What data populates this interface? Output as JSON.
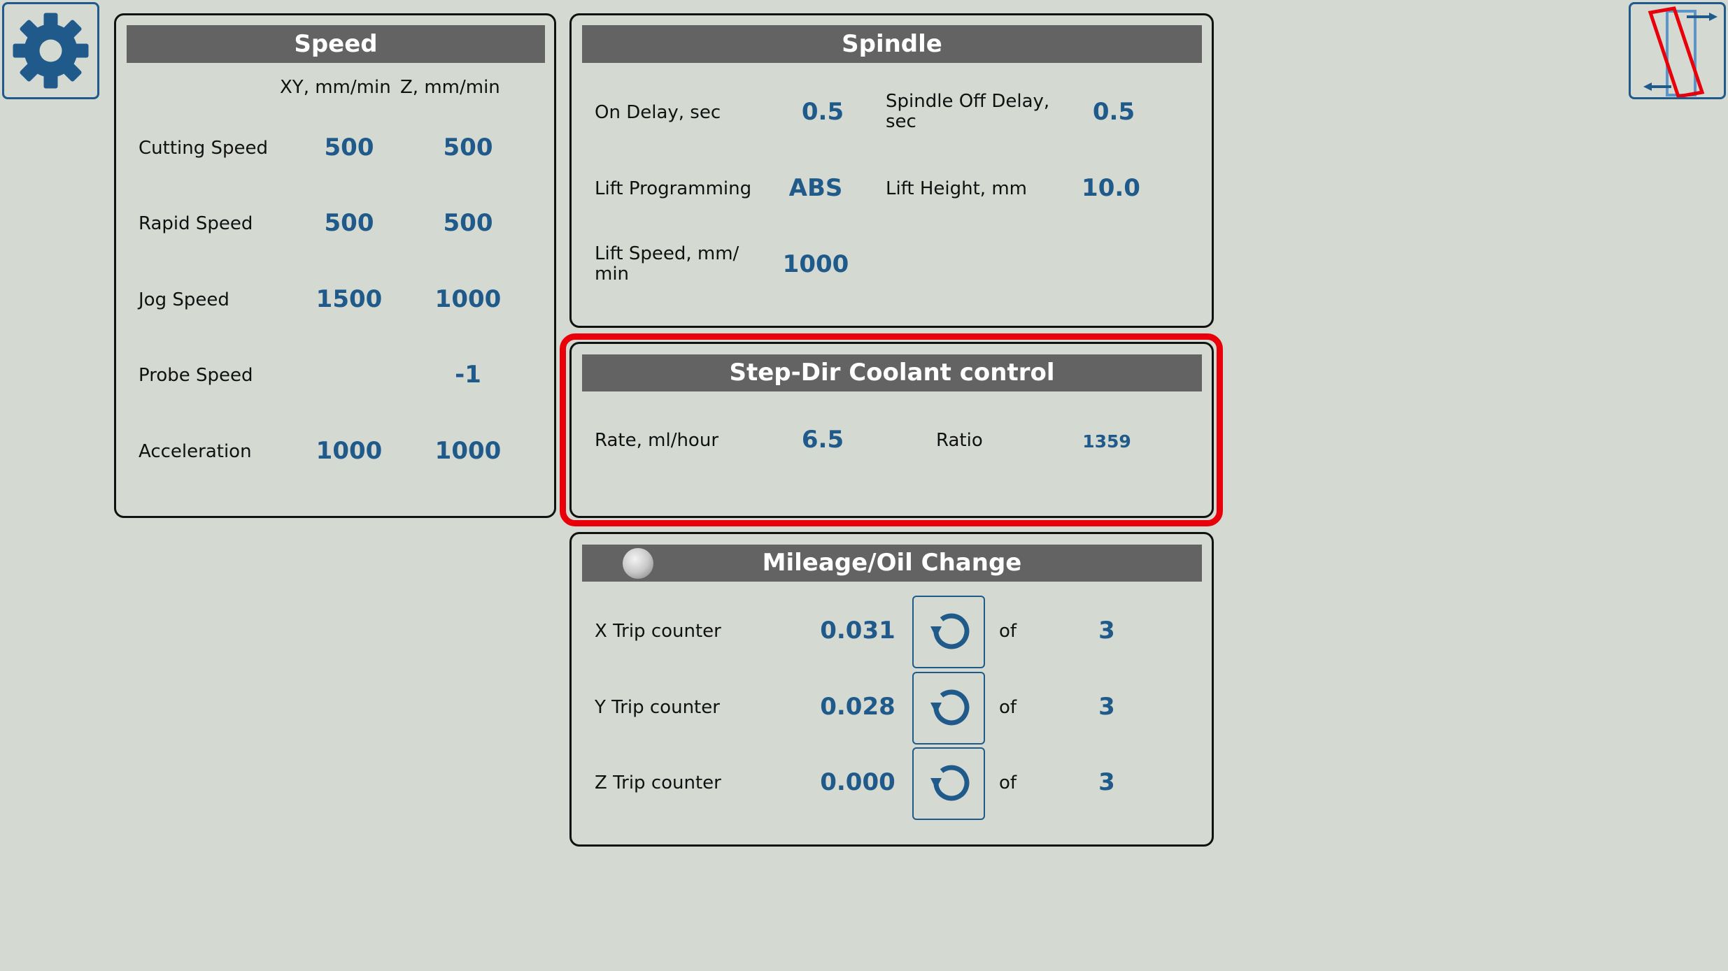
{
  "speed": {
    "title": "Speed",
    "col_xy": "XY, mm/min",
    "col_z": "Z, mm/min",
    "rows": [
      {
        "label": "Cutting Speed",
        "xy": "500",
        "z": "500"
      },
      {
        "label": "Rapid Speed",
        "xy": "500",
        "z": "500"
      },
      {
        "label": "Jog Speed",
        "xy": "1500",
        "z": "1000"
      },
      {
        "label": "Probe Speed",
        "xy": "",
        "z": "-1"
      },
      {
        "label": "Acceleration",
        "xy": "1000",
        "z": "1000"
      }
    ]
  },
  "spindle": {
    "title": "Spindle",
    "on_delay_label": "On Delay, sec",
    "on_delay_value": "0.5",
    "off_delay_label": "Spindle Off Delay, sec",
    "off_delay_value": "0.5",
    "lift_prog_label": "Lift Programming",
    "lift_prog_value": "ABS",
    "lift_height_label": "Lift Height, mm",
    "lift_height_value": "10.0",
    "lift_speed_label": "Lift Speed, mm/ min",
    "lift_speed_value": "1000"
  },
  "coolant": {
    "title": "Step-Dir Coolant control",
    "rate_label": "Rate, ml/hour",
    "rate_value": "6.5",
    "ratio_label": "Ratio",
    "ratio_value": "1359"
  },
  "mileage": {
    "title": "Mileage/Oil Change",
    "of_label": "of",
    "rows": [
      {
        "label": "X Trip counter",
        "value": "0.031",
        "limit": "3"
      },
      {
        "label": "Y Trip counter",
        "value": "0.028",
        "limit": "3"
      },
      {
        "label": "Z Trip counter",
        "value": "0.000",
        "limit": "3"
      }
    ]
  },
  "icons": {
    "settings": "gear-icon",
    "mode": "axis-mode-icon",
    "reset": "reset-icon",
    "status": "status-led-icon"
  },
  "colors": {
    "accent": "#1f5a8a",
    "header_bg": "#636363",
    "highlight": "#e8000a",
    "background": "#d4d9d2"
  }
}
